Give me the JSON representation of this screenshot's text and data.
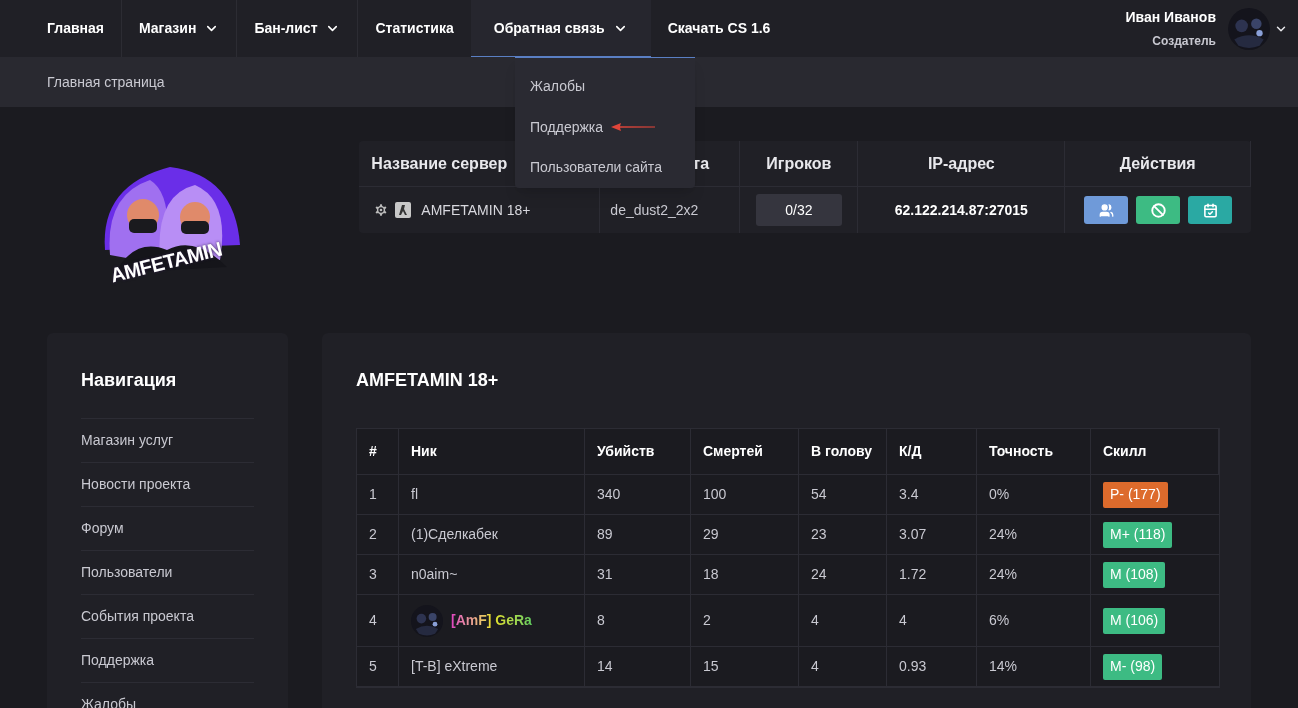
{
  "nav": [
    {
      "label": "Главная",
      "dropdown": false,
      "selected": false
    },
    {
      "label": "Магазин",
      "dropdown": true,
      "selected": false
    },
    {
      "label": "Бан-лист",
      "dropdown": true,
      "selected": false
    },
    {
      "label": "Статистика",
      "dropdown": false,
      "selected": false
    },
    {
      "label": "Обратная связь",
      "dropdown": true,
      "selected": true
    },
    {
      "label": "Скачать CS 1.6",
      "dropdown": false,
      "selected": false
    }
  ],
  "user": {
    "name": "Иван Иванов",
    "role": "Создатель"
  },
  "breadcrumb": "Главная страница",
  "dropdown_menu": [
    {
      "label": "Жалобы",
      "pointed": false
    },
    {
      "label": "Поддержка",
      "pointed": true
    },
    {
      "label": "Пользователи сайта",
      "pointed": false
    }
  ],
  "logo_text": "AMFETAMIN",
  "server_table": {
    "columns": [
      "Название сервер",
      "та",
      "Игроков",
      "IP-адрес",
      "Действия"
    ],
    "rows": [
      {
        "name": "AMFETAMIN 18+",
        "map": "de_dust2_2x2",
        "players": "0/32",
        "ip": "62.122.214.87:27015"
      }
    ]
  },
  "navigation": {
    "title": "Навигация",
    "items": [
      "Магазин услуг",
      "Новости проекта",
      "Форум",
      "Пользователи",
      "События проекта",
      "Поддержка",
      "Жалобы"
    ]
  },
  "stats": {
    "title": "AMFETAMIN 18+",
    "columns": [
      "#",
      "Ник",
      "Убийств",
      "Смертей",
      "В голову",
      "К/Д",
      "Точность",
      "Скилл"
    ],
    "rows": [
      {
        "rank": "1",
        "nick": "fl",
        "avatar": false,
        "kind": "plain",
        "kills": "340",
        "deaths": "100",
        "headshots": "54",
        "kd": "3.4",
        "accuracy": "0%",
        "skill": "P- (177)",
        "color": "#dd6b2c"
      },
      {
        "rank": "2",
        "nick": "(1)Сделкабек",
        "avatar": false,
        "kind": "plain",
        "kills": "89",
        "deaths": "29",
        "headshots": "23",
        "kd": "3.07",
        "accuracy": "24%",
        "skill": "M+ (118)",
        "color": "#3dbb83"
      },
      {
        "rank": "3",
        "nick": "n0aim~",
        "avatar": false,
        "kind": "plain",
        "kills": "31",
        "deaths": "18",
        "headshots": "24",
        "kd": "1.72",
        "accuracy": "24%",
        "skill": "M (108)",
        "color": "#3dbb83"
      },
      {
        "rank": "4",
        "nick": "[AmF] GeRa",
        "avatar": true,
        "kind": "gradient",
        "kills": "8",
        "deaths": "2",
        "headshots": "4",
        "kd": "4",
        "accuracy": "6%",
        "skill": "M (106)",
        "color": "#3dbb83"
      },
      {
        "rank": "5",
        "nick": "[T-B] eXtreme",
        "avatar": false,
        "kind": "plain",
        "kills": "14",
        "deaths": "15",
        "headshots": "4",
        "kd": "0.93",
        "accuracy": "14%",
        "skill": "M- (98)",
        "color": "#3dbb83"
      }
    ]
  }
}
